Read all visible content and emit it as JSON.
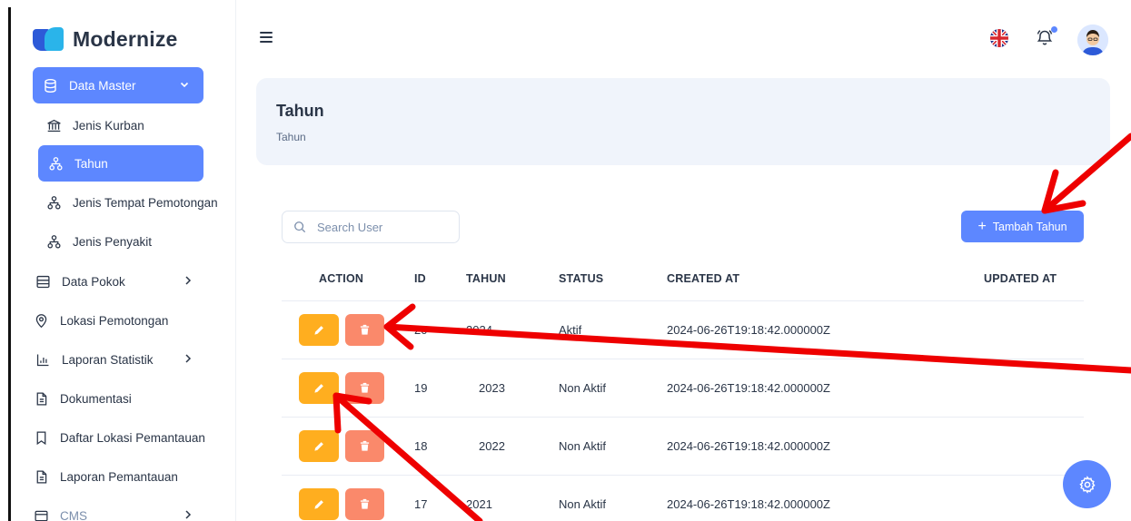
{
  "brand": {
    "name": "Modernize"
  },
  "sidebar": {
    "items": [
      {
        "label": "Data Master",
        "icon": "database-icon"
      },
      {
        "label": "Jenis Kurban",
        "icon": "bank-icon"
      },
      {
        "label": "Tahun",
        "icon": "hierarchy-icon"
      },
      {
        "label": "Jenis Tempat Pemotongan",
        "icon": "hierarchy-icon"
      },
      {
        "label": "Jenis Penyakit",
        "icon": "hierarchy-icon"
      },
      {
        "label": "Data Pokok",
        "icon": "table-icon"
      },
      {
        "label": "Lokasi Pemotongan",
        "icon": "map-pin-icon"
      },
      {
        "label": "Laporan Statistik",
        "icon": "bar-chart-icon"
      },
      {
        "label": "Dokumentasi",
        "icon": "file-text-icon"
      },
      {
        "label": "Daftar Lokasi Pemantauan",
        "icon": "bookmark-icon"
      },
      {
        "label": "Laporan Pemantauan",
        "icon": "file-text-icon"
      },
      {
        "label": "CMS",
        "icon": "cms-icon"
      }
    ]
  },
  "breadcrumb": {
    "title": "Tahun",
    "sub": "Tahun"
  },
  "search": {
    "placeholder": "Search User"
  },
  "add_button": {
    "label": "Tambah Tahun"
  },
  "table": {
    "headers": [
      "ACTION",
      "ID",
      "TAHUN",
      "STATUS",
      "CREATED AT",
      "UPDATED AT"
    ],
    "rows": [
      {
        "id": "20",
        "tahun": "2024",
        "status": "Aktif",
        "created_at": "2024-06-26T19:18:42.000000Z",
        "updated_at": ""
      },
      {
        "id": "19",
        "tahun": "2023",
        "status": "Non Aktif",
        "created_at": "2024-06-26T19:18:42.000000Z",
        "updated_at": ""
      },
      {
        "id": "18",
        "tahun": "2022",
        "status": "Non Aktif",
        "created_at": "2024-06-26T19:18:42.000000Z",
        "updated_at": ""
      },
      {
        "id": "17",
        "tahun": "2021",
        "status": "Non Aktif",
        "created_at": "2024-06-26T19:18:42.000000Z",
        "updated_at": ""
      }
    ]
  },
  "colors": {
    "primary": "#5d87ff",
    "edit": "#ffae1f",
    "delete": "#fa896b",
    "annotation": "#ee0000"
  }
}
